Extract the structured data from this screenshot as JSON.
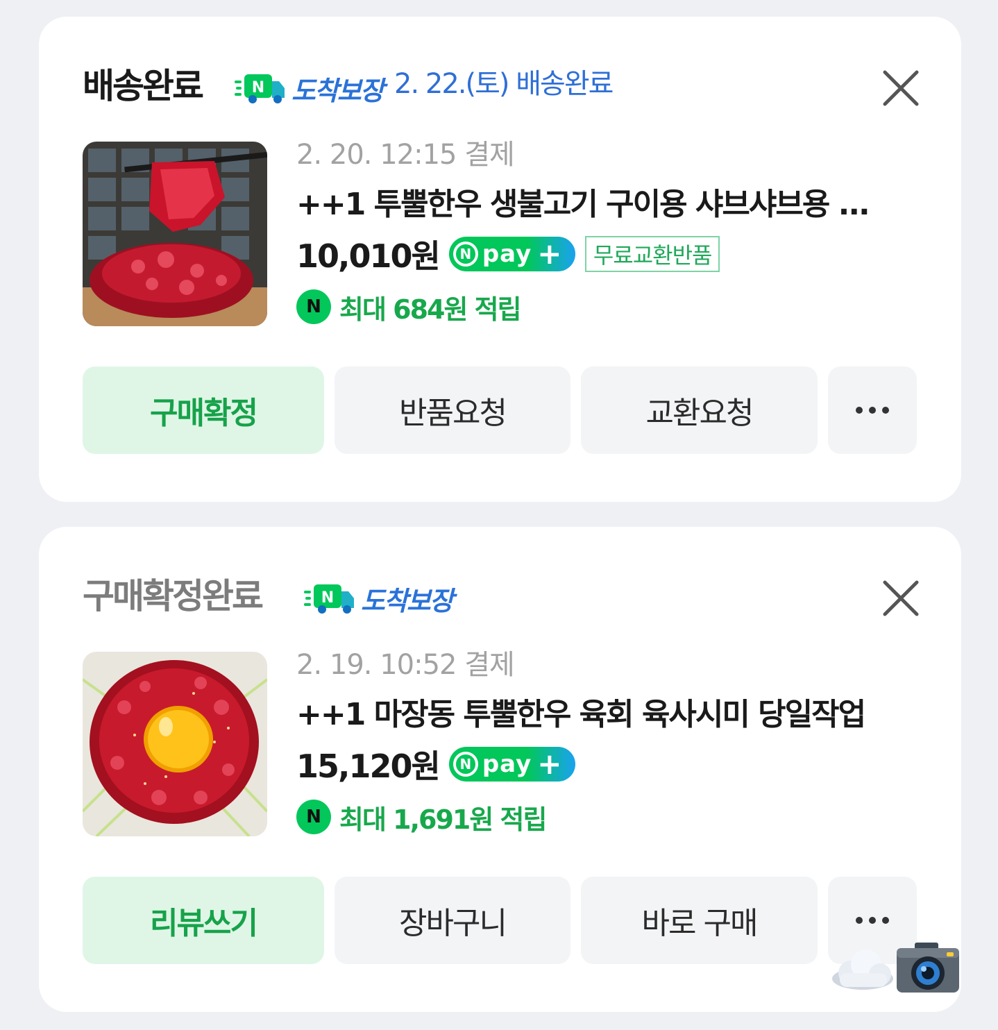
{
  "orders": [
    {
      "status": "배송완료",
      "badge": "도착보장",
      "eta": "2. 22.(토) 배송완료",
      "paid_at": "2. 20. 12:15 결제",
      "product_name": "++1 투뿔한우 생불고기 구이용 샤브샤브용 ...",
      "price": "10,010원",
      "npay_label": "pay",
      "free_exchange": "무료교환반품",
      "reward": "최대 684원 적립",
      "buttons": [
        "구매확정",
        "반품요청",
        "교환요청",
        "..."
      ]
    },
    {
      "status": "구매확정완료",
      "badge": "도착보장",
      "paid_at": "2. 19. 10:52 결제",
      "product_name": "++1 마장동 투뿔한우 육회 육사시미 당일작업",
      "price": "15,120원",
      "npay_label": "pay",
      "reward": "최대 1,691원 적립",
      "buttons": [
        "리뷰쓰기",
        "장바구니",
        "바로 구매",
        "..."
      ]
    }
  ],
  "icons": {
    "truck": "delivery-truck-icon",
    "close": "close-icon",
    "npoint": "naver-point-icon",
    "more": "more-horizontal-icon",
    "cloud": "cloud-icon",
    "camera": "camera-icon"
  },
  "colors": {
    "green": "#03c75a",
    "blue_text": "#2f6fd6",
    "primary_button_bg": "#dff6e6",
    "page_bg": "#eef0f4"
  }
}
